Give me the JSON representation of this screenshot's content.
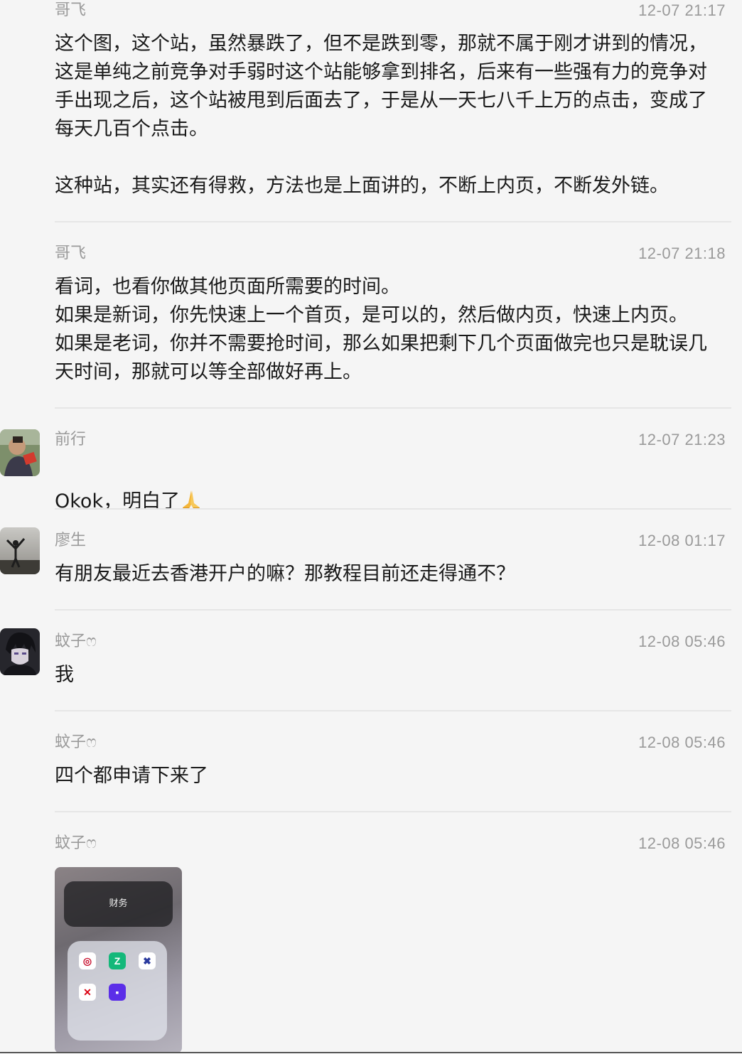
{
  "messages": [
    {
      "sender": "哥飞",
      "time": "12-07 21:17",
      "text": "这个图，这个站，虽然暴跌了，但不是跌到零，那就不属于刚才讲到的情况，\n这是单纯之前竞争对手弱时这个站能够拿到排名，后来有一些强有力的竞争对\n手出现之后，这个站被甩到后面去了，于是从一天七八千上万的点击，变成了\n每天几百个点击。\n\n这种站，其实还有得救，方法也是上面讲的，不断上内页，不断发外链。"
    },
    {
      "sender": "哥飞",
      "time": "12-07 21:18",
      "text": "看词，也看你做其他页面所需要的时间。\n如果是新词，你先快速上一个首页，是可以的，然后做内页，快速上内页。\n如果是老词，你并不需要抢时间，那么如果把剩下几个页面做完也只是耽误几\n天时间，那就可以等全部做好再上。"
    },
    {
      "sender": "前行",
      "time": "12-07 21:23",
      "text": "Okok，明白了",
      "emoji": "pray-hands-emoji"
    },
    {
      "sender": "廖生",
      "time": "12-08 01:17",
      "text": "有朋友最近去香港开户的嘛？那教程目前还走得通不？"
    },
    {
      "sender": "蚊子ෆ",
      "time": "12-08 05:46",
      "text": "我"
    },
    {
      "sender": "蚊子ෆ",
      "time": "12-08 05:46",
      "text": "四个都申请下来了"
    },
    {
      "sender": "蚊子ෆ",
      "time": "12-08 05:46",
      "image": {
        "folder_label": "财务",
        "apps": [
          "bank-app-icon",
          "zhongan-app-icon",
          "za-bank-app-icon",
          "hsbc-app-icon",
          "purple-app-icon"
        ]
      }
    }
  ],
  "colors": {
    "background": "#f5f5f5",
    "meta_text": "#9a9a9a",
    "body_text": "#1a1a1a",
    "divider": "#e6e6e6"
  }
}
